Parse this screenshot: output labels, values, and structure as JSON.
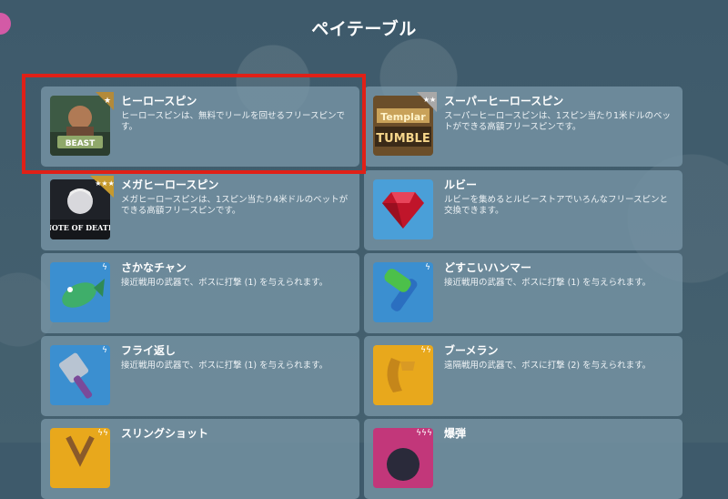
{
  "header": {
    "title": "ペイテーブル"
  },
  "items": [
    {
      "name": "ヒーロースピン",
      "desc": "ヒーロースピンは、無料でリールを回せるフリースピンです。",
      "icon": "beast-mode-slot-icon",
      "badge": "silver-star-ribbon"
    },
    {
      "name": "スーパーヒーロースピン",
      "desc": "スーパーヒーロースピンは、1スピン当たり1米ドルのベットができる高額フリースピンです。",
      "icon": "templar-tumble-slot-icon",
      "badge": "silver-two-star-ribbon"
    },
    {
      "name": "メガヒーロースピン",
      "desc": "メガヒーロースピンは、1スピン当たり4米ドルのベットができる高額フリースピンです。",
      "icon": "note-of-death-slot-icon",
      "badge": "gold-three-star-ribbon"
    },
    {
      "name": "ルビー",
      "desc": "ルビーを集めるとルビーストアでいろんなフリースピンと交換できます。",
      "icon": "ruby-icon",
      "badge": ""
    },
    {
      "name": "さかなチャン",
      "desc": "接近戦用の武器で、ボスに打撃 (1) を与えられます。",
      "icon": "fish-weapon-icon",
      "badge": "single-bolt-ribbon"
    },
    {
      "name": "どすこいハンマー",
      "desc": "接近戦用の武器で、ボスに打撃 (1) を与えられます。",
      "icon": "hammer-weapon-icon",
      "badge": "single-bolt-ribbon"
    },
    {
      "name": "フライ返し",
      "desc": "接近戦用の武器で、ボスに打撃 (1) を与えられます。",
      "icon": "spatula-weapon-icon",
      "badge": "single-bolt-ribbon"
    },
    {
      "name": "ブーメラン",
      "desc": "遠隔戦用の武器で、ボスに打撃 (2) を与えられます。",
      "icon": "boomerang-weapon-icon",
      "badge": "double-bolt-ribbon"
    },
    {
      "name": "スリングショット",
      "desc": "",
      "icon": "slingshot-weapon-icon",
      "badge": "double-bolt-ribbon"
    },
    {
      "name": "爆弾",
      "desc": "",
      "icon": "bomb-weapon-icon",
      "badge": "triple-bolt-ribbon"
    }
  ],
  "colors": {
    "background": "#3e5a6b",
    "card": "#7896a6",
    "highlight": "#e02017"
  }
}
